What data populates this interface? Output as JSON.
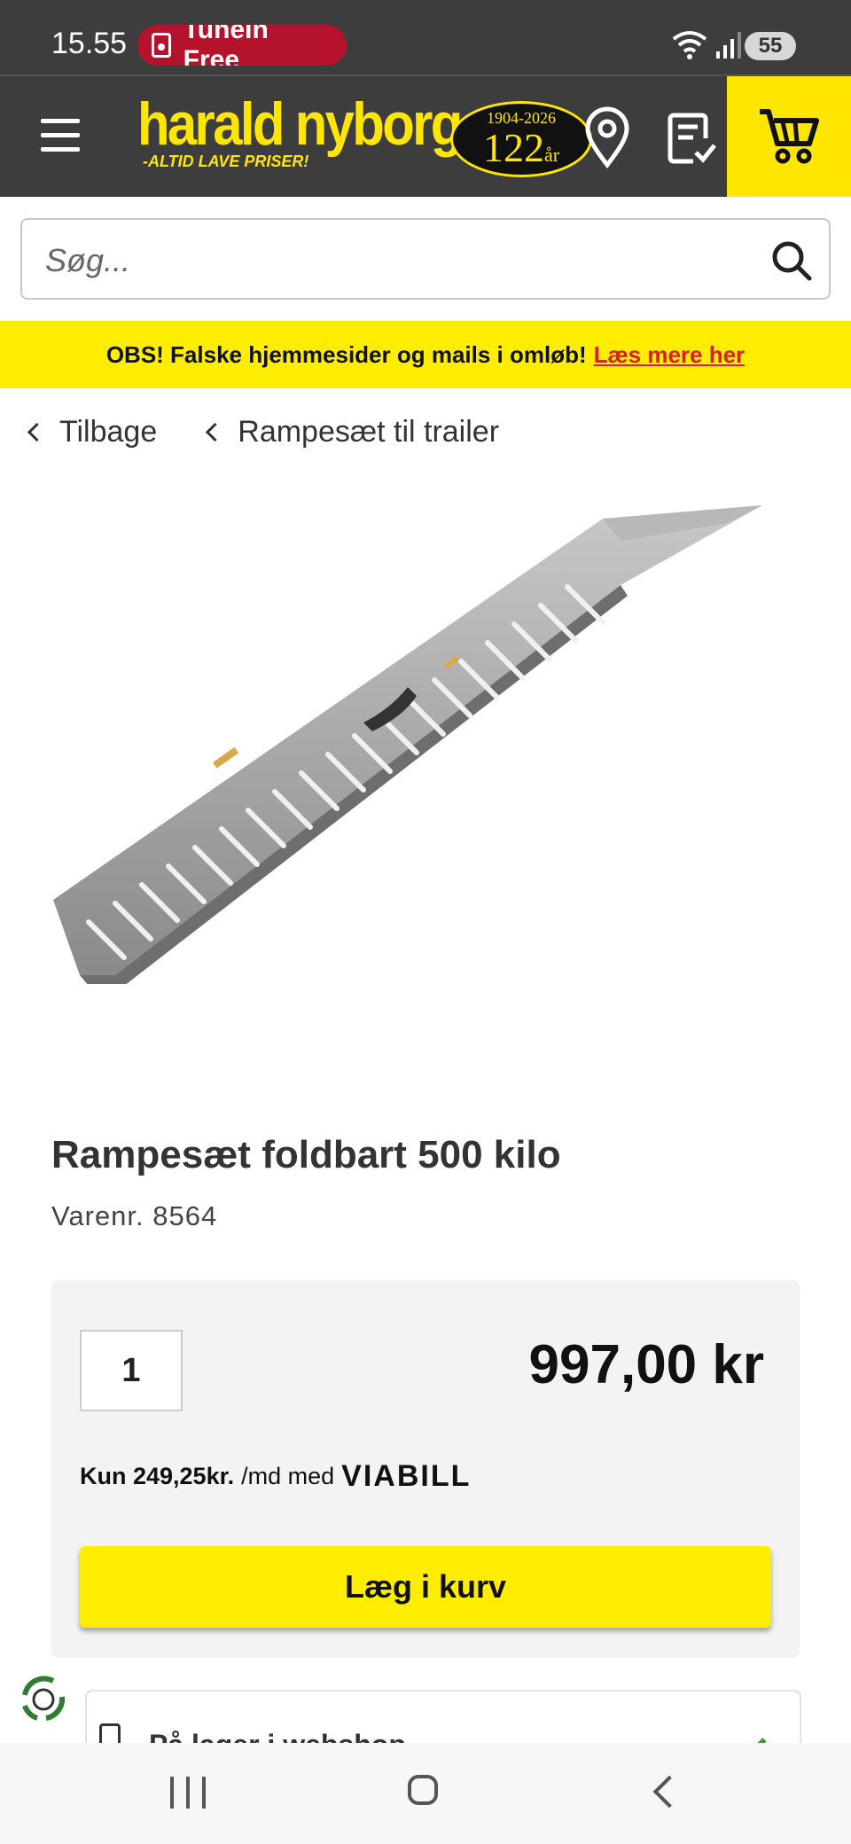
{
  "status_bar": {
    "time": "15.55",
    "notification": "TuneIn Free",
    "battery": "55"
  },
  "header": {
    "logo_text": "harald nyborg",
    "logo_tagline": "-ALTID LAVE PRISER!",
    "anniversary_years": "1904-2026",
    "anniversary_number": "122",
    "anniversary_suffix": "år"
  },
  "search": {
    "placeholder": "Søg..."
  },
  "notice": {
    "text": "OBS! Falske hjemmesider og mails i omløb!",
    "link": "Læs mere her"
  },
  "breadcrumbs": [
    {
      "label": "Tilbage"
    },
    {
      "label": "Rampesæt til trailer"
    }
  ],
  "product": {
    "title": "Rampesæt foldbart 500 kilo",
    "sku": "Varenr. 8564",
    "quantity": "1",
    "price": "997,00 kr",
    "financing_amount": "Kun 249,25kr.",
    "financing_text": "/md med",
    "financing_brand": "VIABILL",
    "add_to_cart": "Læg i kurv"
  },
  "stock": {
    "label": "På lager i webshop"
  },
  "colors": {
    "brand_yellow": "#ffe600",
    "header_bg": "#3d3d3d",
    "notice_link": "#d32222"
  }
}
